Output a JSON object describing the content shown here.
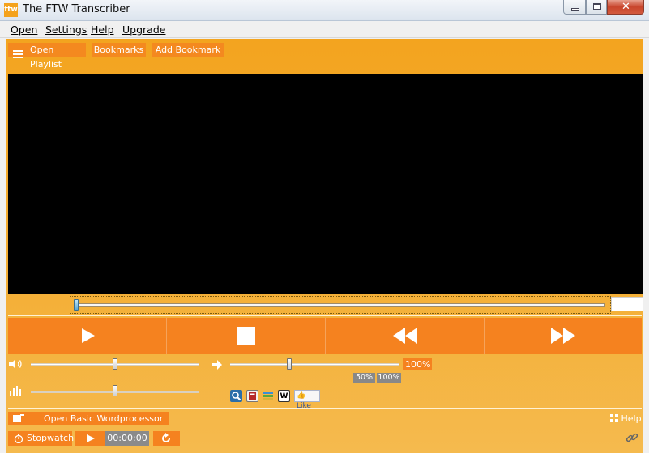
{
  "window": {
    "title": "The FTW Transcriber",
    "icon_text": "ftw"
  },
  "menu": {
    "items": [
      "Open",
      "Settings",
      "Help",
      "Upgrade"
    ]
  },
  "toolbar": {
    "open_playlist": "Open Playlist",
    "bookmarks": "Bookmarks",
    "add_bookmark": "Add Bookmark"
  },
  "playback": {
    "speed_percent": "100%",
    "speed_presets": [
      "50%",
      "100%"
    ],
    "volume_level": 0.5,
    "speed_level": 0.35,
    "eq_level": 0.5,
    "seek_position": 0.0
  },
  "tools": {
    "like_label": "Like",
    "wiki_label": "W"
  },
  "bottom": {
    "wordprocessor_label": "Open Basic Wordprocessor",
    "help_label": "Help",
    "stopwatch_label": "Stopwatch",
    "stopwatch_time": "00:00:00"
  },
  "colors": {
    "accent": "#f5821f",
    "background_top": "#f3a41f",
    "background_bottom": "#f5ba4e"
  }
}
